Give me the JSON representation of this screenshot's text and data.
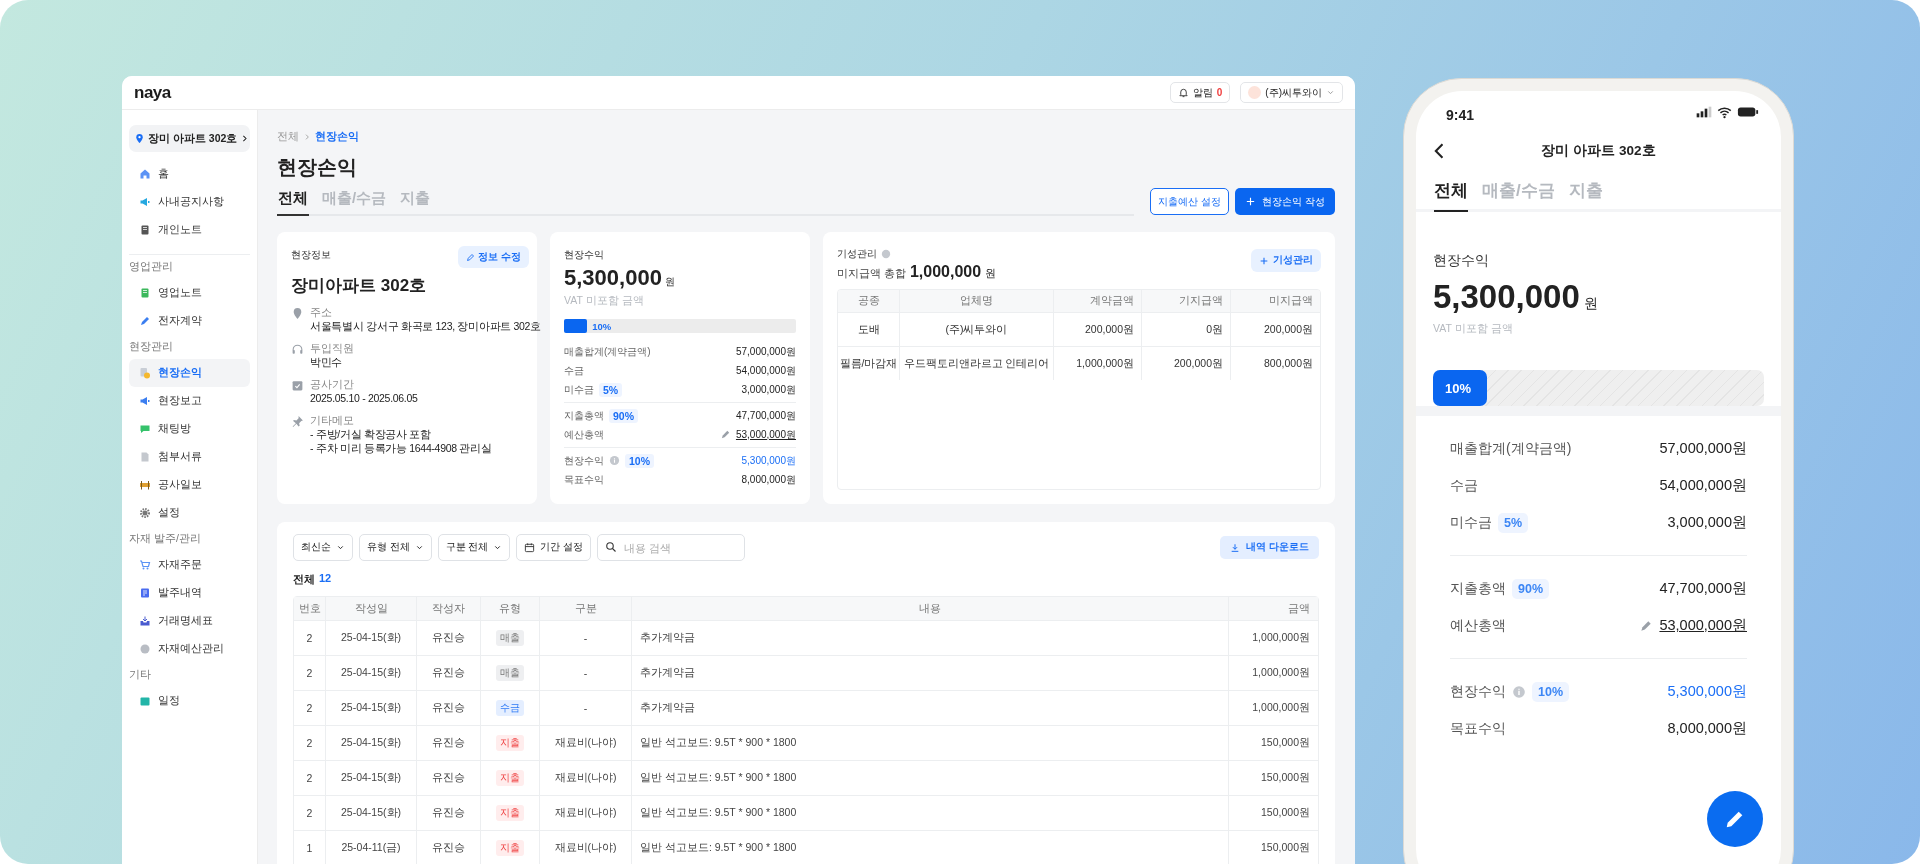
{
  "topbar": {
    "logo": "naya",
    "alerts": {
      "label": "알림",
      "count": "0"
    },
    "account": "(주)씨투와이"
  },
  "sidebar": {
    "site": "장미 아파트 302호",
    "sections": [
      {
        "items": [
          {
            "label": "홈",
            "selected": false
          },
          {
            "label": "사내공지사항",
            "selected": false
          },
          {
            "label": "개인노트",
            "selected": false
          }
        ]
      },
      {
        "title": "영업관리",
        "items": [
          {
            "label": "영업노트",
            "selected": false
          },
          {
            "label": "전자계약",
            "selected": false
          }
        ]
      },
      {
        "title": "현장관리",
        "items": [
          {
            "label": "현장손익",
            "selected": true
          },
          {
            "label": "현장보고",
            "selected": false
          },
          {
            "label": "채팅방",
            "selected": false
          },
          {
            "label": "첨부서류",
            "selected": false
          },
          {
            "label": "공사일보",
            "selected": false
          },
          {
            "label": "설정",
            "selected": false
          }
        ]
      },
      {
        "title": "자재 발주/관리",
        "items": [
          {
            "label": "자재주문",
            "selected": false
          },
          {
            "label": "발주내역",
            "selected": false
          },
          {
            "label": "거래명세표",
            "selected": false
          },
          {
            "label": "자재예산관리",
            "selected": false
          }
        ]
      },
      {
        "title": "기타",
        "items": [
          {
            "label": "일정",
            "selected": false
          }
        ]
      }
    ]
  },
  "page": {
    "breadcrumb": [
      {
        "label": "전체",
        "current": false
      },
      {
        "label": "현장손익",
        "current": true
      }
    ],
    "title": "현장손익",
    "tabs": [
      {
        "label": "전체",
        "selected": true
      },
      {
        "label": "매출/수금",
        "selected": false
      },
      {
        "label": "지출",
        "selected": false
      }
    ],
    "buttons": [
      {
        "label": "지출예산 설정",
        "kind": "outline"
      },
      {
        "label": "현장손익 작성",
        "kind": "primary"
      }
    ]
  },
  "site_info": {
    "title": "현장정보",
    "edit_button": "정보 수정",
    "name": "장미아파트 302호",
    "fields": [
      {
        "kind": "location",
        "label": "주소",
        "value": "서울특별시 강서구 화곡로 123, 장미아파트 302호"
      },
      {
        "kind": "headset",
        "label": "투입직원",
        "value": "박민수"
      },
      {
        "kind": "calendar",
        "label": "공사기간",
        "value": "2025.05.10 - 2025.06.05"
      },
      {
        "kind": "pin",
        "label": "기타메모",
        "value": "- 주방/거실 확장공사 포함\n- 주차 미리 등록가능 1644-4908 관리실"
      }
    ]
  },
  "revenue": {
    "title": "현장수익",
    "amount": "5,300,000",
    "unit": "원",
    "note": "VAT 미포함 금액",
    "progress": {
      "level": 0.1,
      "label": "10%"
    },
    "groups": [
      [
        {
          "label": "매출합계(계약금액)",
          "value": "57,000,000원",
          "kind": "plain",
          "info": false
        },
        {
          "label": "수금",
          "value": "54,000,000원",
          "kind": "plain",
          "info": false
        },
        {
          "label": "미수금",
          "badge": "5%",
          "value": "3,000,000원",
          "kind": "plain",
          "info": false
        }
      ],
      [
        {
          "label": "지출총액",
          "badge": "90%",
          "value": "47,700,000원",
          "kind": "plain",
          "info": false
        },
        {
          "label": "예산총액",
          "value": "53,000,000원",
          "kind": "budget",
          "info": false
        }
      ],
      [
        {
          "label": "현장수익",
          "badge": "10%",
          "value": "5,300,000원",
          "kind": "profit",
          "info": true
        },
        {
          "label": "목표수익",
          "value": "8,000,000원",
          "kind": "plain",
          "info": false
        }
      ]
    ]
  },
  "progress_payments": {
    "title": "기성관리",
    "summary_label": "미지급액 총합",
    "amount": "1,000,000",
    "unit": "원",
    "button": "기성관리",
    "columns": [
      "공종",
      "업체명",
      "계약금액",
      "기지급액",
      "미지급액"
    ],
    "rows": [
      [
        "도배",
        "(주)씨투와이",
        "200,000원",
        "0원",
        "200,000원"
      ],
      [
        "필름/마감재",
        "우드팩토리앤라르고 인테리어",
        "1,000,000원",
        "200,000원",
        "800,000원"
      ]
    ]
  },
  "ledger": {
    "filters": [
      {
        "kind": "dropdown",
        "label": "최신순"
      },
      {
        "kind": "dropdown",
        "label": "유형 전체"
      },
      {
        "kind": "dropdown",
        "label": "구분 전체"
      },
      {
        "kind": "date",
        "label": "기간 설정"
      }
    ],
    "search": {
      "placeholder": "내용 검색"
    },
    "download": "내역 다운로드",
    "total_label": "전체",
    "total_count": "12",
    "columns": [
      "번호",
      "작성일",
      "작성자",
      "유형",
      "구분",
      "내용",
      "금액"
    ],
    "rows": [
      {
        "no": "2",
        "date": "25-04-15(화)",
        "author": "유진승",
        "type": "매출",
        "kind": "sales",
        "category": "-",
        "content": "추가계약금",
        "amount": "1,000,000원"
      },
      {
        "no": "2",
        "date": "25-04-15(화)",
        "author": "유진승",
        "type": "매출",
        "kind": "sales",
        "category": "-",
        "content": "추가계약금",
        "amount": "1,000,000원"
      },
      {
        "no": "2",
        "date": "25-04-15(화)",
        "author": "유진승",
        "type": "수금",
        "kind": "receipt",
        "category": "-",
        "content": "추가계약금",
        "amount": "1,000,000원"
      },
      {
        "no": "2",
        "date": "25-04-15(화)",
        "author": "유진승",
        "type": "지출",
        "kind": "expense",
        "category": "재료비(나야)",
        "content": "일반 석고보드: 9.5T * 900 * 1800",
        "amount": "150,000원"
      },
      {
        "no": "2",
        "date": "25-04-15(화)",
        "author": "유진승",
        "type": "지출",
        "kind": "expense",
        "category": "재료비(나야)",
        "content": "일반 석고보드: 9.5T * 900 * 1800",
        "amount": "150,000원"
      },
      {
        "no": "2",
        "date": "25-04-15(화)",
        "author": "유진승",
        "type": "지출",
        "kind": "expense",
        "category": "재료비(나야)",
        "content": "일반 석고보드: 9.5T * 900 * 1800",
        "amount": "150,000원"
      },
      {
        "no": "1",
        "date": "25-04-11(금)",
        "author": "유진승",
        "type": "지출",
        "kind": "expense",
        "category": "재료비(나야)",
        "content": "일반 석고보드: 9.5T * 900 * 1800",
        "amount": "150,000원"
      }
    ]
  },
  "phone": {
    "time": "9:41",
    "title": "장미 아파트 302호",
    "tabs": [
      {
        "label": "전체",
        "selected": true
      },
      {
        "label": "매출/수금",
        "selected": false
      },
      {
        "label": "지출",
        "selected": false
      }
    ],
    "revenue": {
      "title": "현장수익",
      "amount": "5,300,000",
      "unit": "원",
      "note": "VAT 미포함 금액",
      "progress": {
        "level": 0.1,
        "label": "10%"
      },
      "groups": [
        [
          {
            "label": "매출합계(계약금액)",
            "value": "57,000,000원",
            "kind": "plain",
            "info": false
          },
          {
            "label": "수금",
            "value": "54,000,000원",
            "kind": "plain",
            "info": false
          },
          {
            "label": "미수금",
            "badge": "5%",
            "value": "3,000,000원",
            "kind": "plain",
            "info": false
          }
        ],
        [
          {
            "label": "지출총액",
            "badge": "90%",
            "value": "47,700,000원",
            "kind": "plain",
            "info": false
          },
          {
            "label": "예산총액",
            "value": "53,000,000원",
            "kind": "budget",
            "info": false
          }
        ],
        [
          {
            "label": "현장수익",
            "badge": "10%",
            "value": "5,300,000원",
            "kind": "profit",
            "info": true
          },
          {
            "label": "목표수익",
            "value": "8,000,000원",
            "kind": "plain",
            "info": false
          }
        ]
      ]
    }
  }
}
